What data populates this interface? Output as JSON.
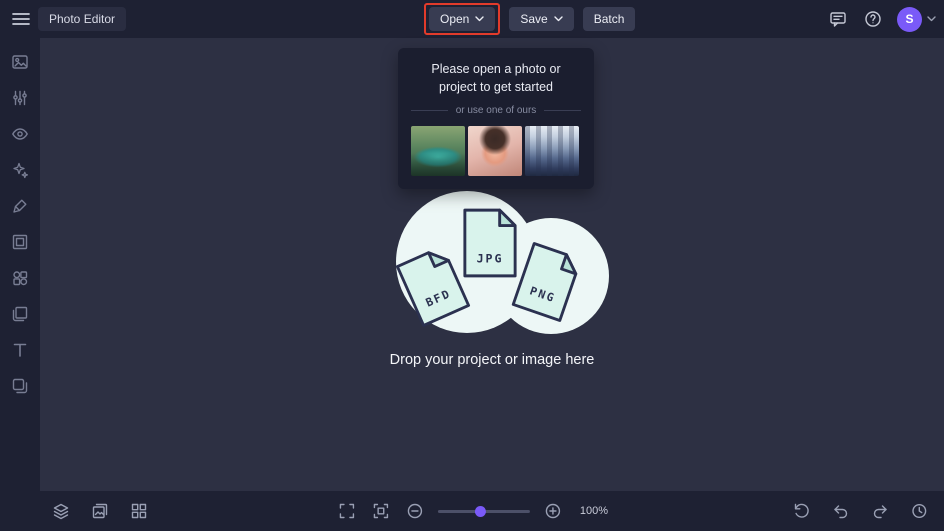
{
  "topbar": {
    "app_title": "Photo Editor",
    "open_label": "Open",
    "save_label": "Save",
    "batch_label": "Batch",
    "avatar_initial": "S",
    "icons": [
      "menu-icon",
      "feedback-icon",
      "help-icon",
      "chevron-down-icon"
    ]
  },
  "annotation": {
    "target": "open-button",
    "color": "#e23b2b"
  },
  "sidebar": {
    "items": [
      "photos-icon",
      "adjust-icon",
      "eye-icon",
      "effects-icon",
      "touchup-icon",
      "frames-icon",
      "graphics-icon",
      "overlays-icon",
      "text-icon",
      "textures-icon"
    ]
  },
  "popup": {
    "title": "Please open a photo or project to get started",
    "divider_label": "or use one of ours",
    "samples": [
      "van-photo",
      "portrait-photo",
      "city-photo"
    ]
  },
  "stage": {
    "drop_label": "Drop your project or image here",
    "files": [
      {
        "label": "BFD"
      },
      {
        "label": "JPG"
      },
      {
        "label": "PNG"
      }
    ]
  },
  "bottombar": {
    "zoom_value": "100%",
    "left_icons": [
      "layers-icon",
      "image-manager-icon",
      "grid-icon"
    ],
    "center_icons": [
      "fullscreen-icon",
      "fit-screen-icon",
      "zoom-out-icon",
      "zoom-in-icon"
    ],
    "right_icons": [
      "reset-icon",
      "undo-icon",
      "redo-icon",
      "history-icon"
    ]
  },
  "colors": {
    "topbar_bg": "#1e2133",
    "canvas_bg": "#2d3043",
    "accent_purple": "#7a5af8",
    "annotation_red": "#e23b2b",
    "blob_fill": "#edf7f6",
    "doc_fill": "#d9f3ec"
  }
}
